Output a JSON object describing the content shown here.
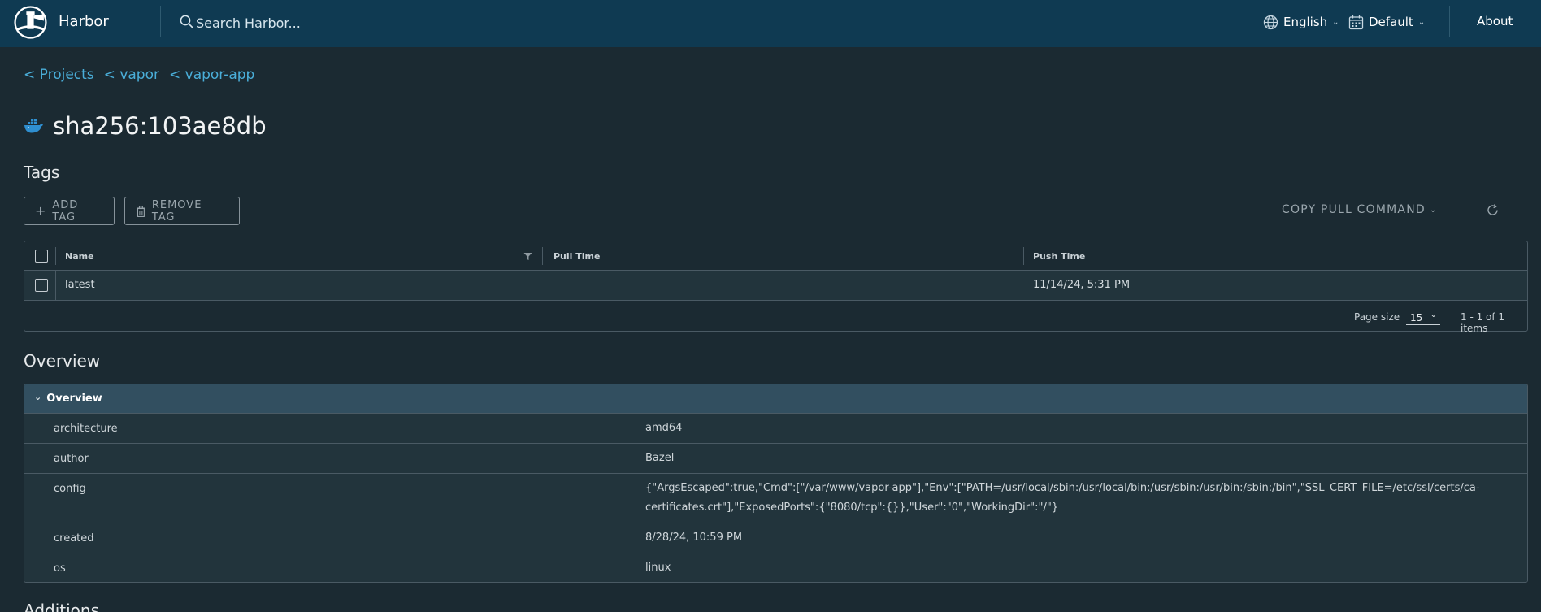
{
  "header": {
    "brand": "Harbor",
    "search_placeholder": "Search Harbor...",
    "language": "English",
    "theme": "Default",
    "about": "About"
  },
  "breadcrumb": [
    "< Projects",
    "< vapor",
    "< vapor-app"
  ],
  "artifact": {
    "title": "sha256:103ae8db",
    "icon": "docker-whale-icon"
  },
  "tags": {
    "section_title": "Tags",
    "add_tag_label": "ADD TAG",
    "remove_tag_label": "REMOVE TAG",
    "copy_pull_label": "COPY PULL COMMAND",
    "columns": [
      "Name",
      "Pull Time",
      "Push Time"
    ],
    "rows": [
      {
        "name": "latest",
        "pull_time": "",
        "push_time": "11/14/24, 5:31 PM"
      }
    ],
    "page_size_label": "Page size",
    "page_size_value": "15",
    "item_count": "1 - 1 of 1 items"
  },
  "overview": {
    "section_title": "Overview",
    "panel_title": "Overview",
    "rows": [
      {
        "key": "architecture",
        "value": "amd64"
      },
      {
        "key": "author",
        "value": "Bazel"
      },
      {
        "key": "config",
        "value": "{\"ArgsEscaped\":true,\"Cmd\":[\"/var/www/vapor-app\"],\"Env\":[\"PATH=/usr/local/sbin:/usr/local/bin:/usr/sbin:/usr/bin:/sbin:/bin\",\"SSL_CERT_FILE=/etc/ssl/certs/ca-certificates.crt\"],\"ExposedPorts\":{\"8080/tcp\":{}},\"User\":\"0\",\"WorkingDir\":\"/\"}"
      },
      {
        "key": "created",
        "value": "8/28/24, 10:59 PM"
      },
      {
        "key": "os",
        "value": "linux"
      }
    ]
  },
  "additions_title": "Additions",
  "colors": {
    "header_bg": "#0f3a52",
    "page_bg": "#1b2a32",
    "link": "#4aaed9",
    "panel_header": "#324f60"
  }
}
